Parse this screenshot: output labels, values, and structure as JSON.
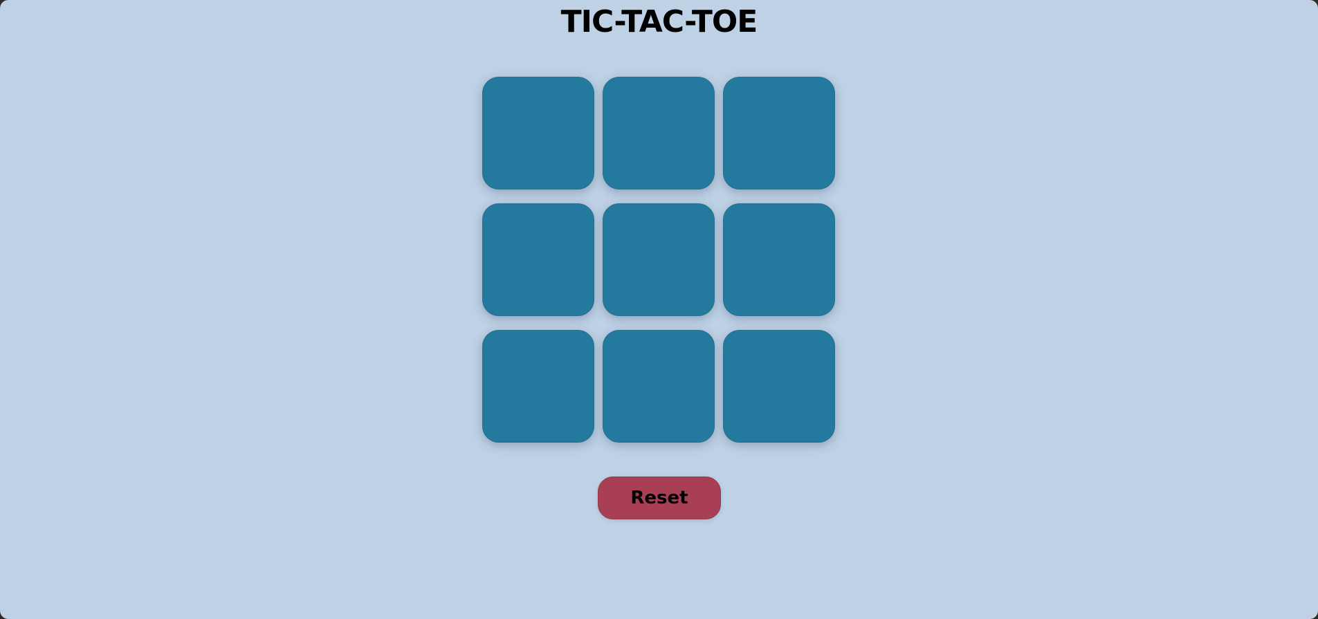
{
  "app": {
    "title": "TIC-TAC-TOE"
  },
  "board": {
    "cells": [
      "",
      "",
      "",
      "",
      "",
      "",
      "",
      "",
      ""
    ]
  },
  "controls": {
    "reset_label": "Reset"
  },
  "colors": {
    "background": "#bed1e5",
    "cell": "#237a9e",
    "reset_button": "#a83f55",
    "text": "#000000"
  }
}
